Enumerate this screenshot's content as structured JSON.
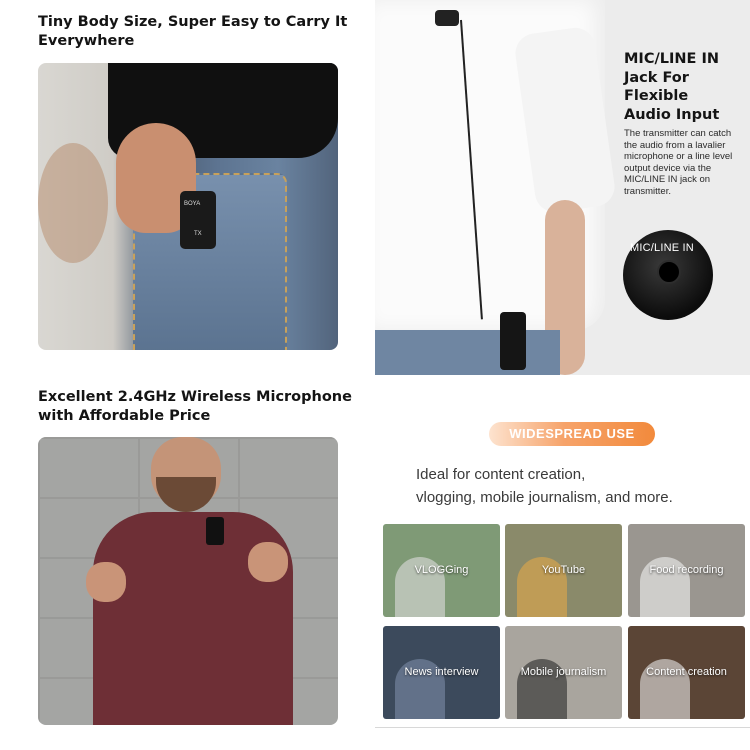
{
  "panel1": {
    "heading_line1": "Tiny Body Size, Super Easy to Carry It",
    "heading_line2": "Everywhere",
    "device_logo": "BOYA",
    "device_tag": "TX"
  },
  "panel2": {
    "title_line1": "MIC/LINE IN",
    "title_line2": "Jack For",
    "title_line3": "Flexible",
    "title_line4": "Audio Input",
    "description": "The transmitter can catch the audio from a lavalier microphone or a line level output device via the MIC/LINE IN jack on transmitter.",
    "jack_label": "MIC/LINE IN"
  },
  "panel3": {
    "heading_line1": "Excellent 2.4GHz Wireless Microphone",
    "heading_line2": "with Affordable Price"
  },
  "panel4": {
    "badge": "WIDESPREAD USE",
    "text_line1": "Ideal for content creation,",
    "text_line2": "vlogging, mobile journalism, and more.",
    "tiles": [
      {
        "label": "VLOGGing",
        "color": "#7f9a76"
      },
      {
        "label": "YouTube",
        "color": "#8a8a6a"
      },
      {
        "label": "Food recording",
        "color": "#9a9690"
      },
      {
        "label": "News interview",
        "color": "#3c4a5c"
      },
      {
        "label": "Mobile journalism",
        "color": "#a9a59e"
      },
      {
        "label": "Content creation",
        "color": "#5b4536"
      }
    ]
  },
  "colors": {
    "accent": "#f28a3c",
    "heading": "#141414"
  }
}
